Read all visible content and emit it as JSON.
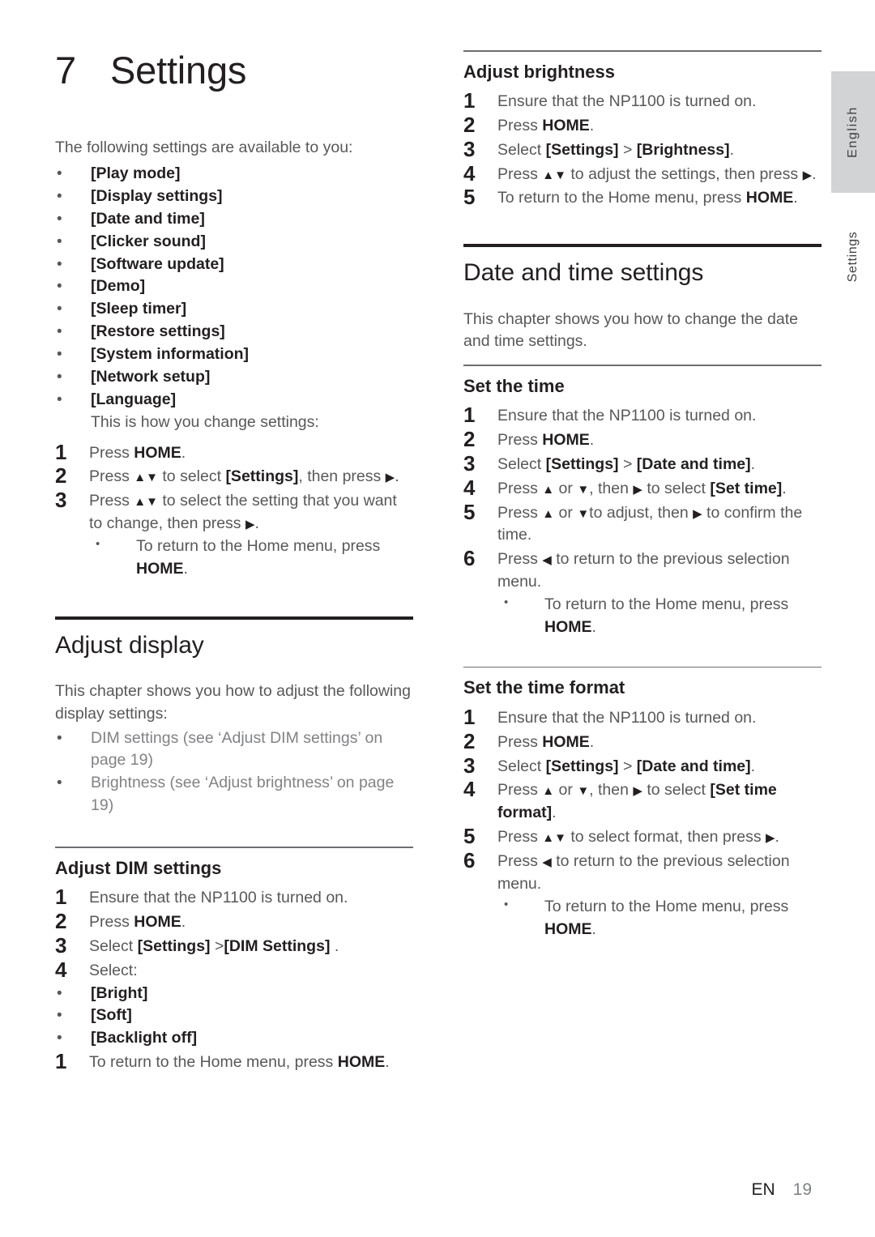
{
  "document": {
    "chapter_number": "7",
    "chapter_title": "Settings",
    "side_tab_language": "English",
    "side_tab_chapter": "Settings",
    "footer_language_code": "EN",
    "footer_page_number": "19",
    "accent_rule_color": "#231f20",
    "body_text_color": "#58585a",
    "side_tab_bg_color": "#d1d3d4"
  },
  "intro": {
    "lead": "The following settings are available to you:",
    "settings_list": [
      "[Play mode]",
      "[Display settings]",
      "[Date and time]",
      "[Clicker sound]",
      "[Software update]",
      "[Demo]",
      "[Sleep timer]",
      "[Restore settings]",
      "[System information]",
      "[Network setup]",
      "[Language]"
    ],
    "how_to": "This is how you change settings:",
    "steps": [
      {
        "num": "1",
        "pre": "Press ",
        "bold": "HOME",
        "post": "."
      },
      {
        "num": "2",
        "pre": "Press ",
        "glyph1": "▲▼",
        "mid": " to select ",
        "bold": "[Settings]",
        "post": ", then press ",
        "glyph2": "▶",
        "tail": "."
      },
      {
        "num": "3",
        "pre": "Press ",
        "glyph1": "▲▼",
        "mid": " to select the setting that you want to change, then press ",
        "glyph2": "▶",
        "tail": "."
      }
    ],
    "step3_note_pre": "To return to the Home menu, press ",
    "step3_note_bold": "HOME",
    "step3_note_post": "."
  },
  "adjust_display": {
    "title": "Adjust display",
    "body": "This chapter shows you how to adjust the following display settings:",
    "xrefs": [
      "DIM settings (see ‘Adjust DIM settings’ on page 19)",
      "Brightness (see ‘Adjust brightness’ on page 19)"
    ]
  },
  "adjust_dim": {
    "title": "Adjust DIM settings",
    "steps": [
      {
        "num": "1",
        "text": "Ensure that the NP1100 is turned on."
      },
      {
        "num": "2",
        "pre": "Press ",
        "bold": "HOME",
        "post": "."
      },
      {
        "num": "3",
        "pre": "Select ",
        "bold": "[Settings]",
        "mid": " >",
        "bold2": "[DIM Settings]",
        "post": " ."
      },
      {
        "num": "4",
        "text": "Select:"
      }
    ],
    "options": [
      "[Bright]",
      "[Soft]",
      "[Backlight off]"
    ],
    "final_step": {
      "num": "1",
      "pre": "To return to the Home menu, press ",
      "bold": "HOME",
      "post": "."
    }
  },
  "adjust_brightness": {
    "title": "Adjust brightness",
    "steps": [
      {
        "num": "1",
        "text": "Ensure that the NP1100 is turned on."
      },
      {
        "num": "2",
        "pre": "Press ",
        "bold": "HOME",
        "post": "."
      },
      {
        "num": "3",
        "pre": "Select ",
        "bold": "[Settings]",
        "mid": " > ",
        "bold2": "[Brightness]",
        "post": "."
      },
      {
        "num": "4",
        "pre": "Press ",
        "glyph1": "▲▼",
        "mid": " to adjust the settings, then press ",
        "glyph2": "▶",
        "post": "."
      },
      {
        "num": "5",
        "pre": "To return to the Home menu, press ",
        "bold": "HOME",
        "post": "."
      }
    ]
  },
  "date_time_settings": {
    "title": "Date and time settings",
    "body": "This chapter shows you how to change the date and time settings."
  },
  "set_the_time": {
    "title": "Set the time",
    "steps": [
      {
        "num": "1",
        "text": "Ensure that the NP1100 is turned on."
      },
      {
        "num": "2",
        "pre": "Press ",
        "bold": "HOME",
        "post": "."
      },
      {
        "num": "3",
        "pre": "Select ",
        "bold": "[Settings]",
        "mid": " > ",
        "bold2": "[Date and time]",
        "post": "."
      },
      {
        "num": "4",
        "pre": "Press ",
        "glyph1": "▲",
        "mid": " or ",
        "glyph2": "▼",
        "mid2": ", then ",
        "glyph3": "▶",
        "mid3": " to select ",
        "bold2": "[Set time]",
        "post": "."
      },
      {
        "num": "5",
        "pre": "Press ",
        "glyph1": "▲",
        "mid": " or ",
        "glyph2": "▼",
        "mid2": "to adjust, then ",
        "glyph3": "▶",
        "post": " to confirm the time."
      },
      {
        "num": "6",
        "pre": "Press ",
        "glyph1": "◀",
        "post": " to return to the previous selection menu."
      }
    ],
    "note_pre": "To return to the Home menu, press ",
    "note_bold": "HOME",
    "note_post": "."
  },
  "set_the_time_format": {
    "title": "Set the time format",
    "steps": [
      {
        "num": "1",
        "text": "Ensure that the NP1100 is turned on."
      },
      {
        "num": "2",
        "pre": "Press ",
        "bold": "HOME",
        "post": "."
      },
      {
        "num": "3",
        "pre": "Select ",
        "bold": "[Settings]",
        "mid": " > ",
        "bold2": "[Date and time]",
        "post": "."
      },
      {
        "num": "4",
        "pre": "Press ",
        "glyph1": "▲",
        "mid": " or ",
        "glyph2": "▼",
        "mid2": ", then ",
        "glyph3": "▶",
        "mid3": " to select ",
        "bold2": "[Set time format]",
        "post": "."
      },
      {
        "num": "5",
        "pre": "Press ",
        "glyph1": "▲▼",
        "mid": " to select format, then press ",
        "glyph3": "▶",
        "post": "."
      },
      {
        "num": "6",
        "pre": "Press ",
        "glyph1": "◀",
        "post": " to return to the previous selection menu."
      }
    ],
    "note_pre": "To return to the Home menu, press ",
    "note_bold": "HOME",
    "note_post": "."
  }
}
